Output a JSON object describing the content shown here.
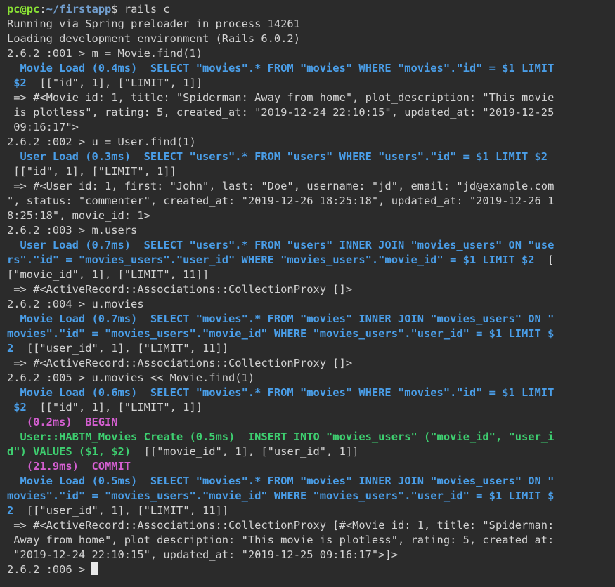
{
  "colors": {
    "background": "#2b2b2b",
    "default": "#d3d3d3",
    "prompt_user": "#8ae234",
    "prompt_path": "#729fcf",
    "sql_blue": "#4a9ee8",
    "sql_magenta": "#d45fd0",
    "sql_green": "#3ecf70"
  },
  "terminal": {
    "lines": [
      [
        {
          "t": "pc@pc",
          "c": "prompt_user",
          "b": true
        },
        {
          "t": ":",
          "c": "default"
        },
        {
          "t": "~/firstapp",
          "c": "prompt_path",
          "b": true
        },
        {
          "t": "$ rails c",
          "c": "default"
        }
      ],
      [
        {
          "t": "Running via Spring preloader in process 14261",
          "c": "default"
        }
      ],
      [
        {
          "t": "Loading development environment (Rails 6.0.2)",
          "c": "default"
        }
      ],
      [
        {
          "t": "2.6.2 :001 > m = Movie.find(1)",
          "c": "default"
        }
      ],
      [
        {
          "t": "  Movie Load (0.4ms)  SELECT \"movies\".* FROM \"movies\" WHERE \"movies\".\"id\" = $1 LIMIT",
          "c": "sql_blue",
          "b": true
        }
      ],
      [
        {
          "t": " $2",
          "c": "sql_blue",
          "b": true
        },
        {
          "t": "  [[\"id\", 1], [\"LIMIT\", 1]]",
          "c": "default"
        }
      ],
      [
        {
          "t": " => #<Movie id: 1, title: \"Spiderman: Away from home\", plot_description: \"This movie",
          "c": "default"
        }
      ],
      [
        {
          "t": " is plotless\", rating: 5, created_at: \"2019-12-24 22:10:15\", updated_at: \"2019-12-25",
          "c": "default"
        }
      ],
      [
        {
          "t": " 09:16:17\">",
          "c": "default"
        }
      ],
      [
        {
          "t": "2.6.2 :002 > u = User.find(1)",
          "c": "default"
        }
      ],
      [
        {
          "t": "  User Load (0.3ms)  SELECT \"users\".* FROM \"users\" WHERE \"users\".\"id\" = $1 LIMIT $2",
          "c": "sql_blue",
          "b": true
        }
      ],
      [
        {
          "t": " [[\"id\", 1], [\"LIMIT\", 1]]",
          "c": "default"
        }
      ],
      [
        {
          "t": " => #<User id: 1, first: \"John\", last: \"Doe\", username: \"jd\", email: \"jd@example.com",
          "c": "default"
        }
      ],
      [
        {
          "t": "\", status: \"commenter\", created_at: \"2019-12-26 18:25:18\", updated_at: \"2019-12-26 1",
          "c": "default"
        }
      ],
      [
        {
          "t": "8:25:18\", movie_id: 1>",
          "c": "default"
        }
      ],
      [
        {
          "t": "2.6.2 :003 > m.users",
          "c": "default"
        }
      ],
      [
        {
          "t": "  User Load (0.7ms)  SELECT \"users\".* FROM \"users\" INNER JOIN \"movies_users\" ON \"use",
          "c": "sql_blue",
          "b": true
        }
      ],
      [
        {
          "t": "rs\".\"id\" = \"movies_users\".\"user_id\" WHERE \"movies_users\".\"movie_id\" = $1 LIMIT $2",
          "c": "sql_blue",
          "b": true
        },
        {
          "t": "  [",
          "c": "default"
        }
      ],
      [
        {
          "t": "[\"movie_id\", 1], [\"LIMIT\", 11]]",
          "c": "default"
        }
      ],
      [
        {
          "t": " => #<ActiveRecord::Associations::CollectionProxy []>",
          "c": "default"
        }
      ],
      [
        {
          "t": "2.6.2 :004 > u.movies",
          "c": "default"
        }
      ],
      [
        {
          "t": "  Movie Load (0.7ms)  SELECT \"movies\".* FROM \"movies\" INNER JOIN \"movies_users\" ON \"",
          "c": "sql_blue",
          "b": true
        }
      ],
      [
        {
          "t": "movies\".\"id\" = \"movies_users\".\"movie_id\" WHERE \"movies_users\".\"user_id\" = $1 LIMIT $",
          "c": "sql_blue",
          "b": true
        }
      ],
      [
        {
          "t": "2",
          "c": "sql_blue",
          "b": true
        },
        {
          "t": "  [[\"user_id\", 1], [\"LIMIT\", 11]]",
          "c": "default"
        }
      ],
      [
        {
          "t": " => #<ActiveRecord::Associations::CollectionProxy []>",
          "c": "default"
        }
      ],
      [
        {
          "t": "2.6.2 :005 > u.movies << Movie.find(1)",
          "c": "default"
        }
      ],
      [
        {
          "t": "  Movie Load (0.6ms)  SELECT \"movies\".* FROM \"movies\" WHERE \"movies\".\"id\" = $1 LIMIT",
          "c": "sql_blue",
          "b": true
        }
      ],
      [
        {
          "t": " $2",
          "c": "sql_blue",
          "b": true
        },
        {
          "t": "  [[\"id\", 1], [\"LIMIT\", 1]]",
          "c": "default"
        }
      ],
      [
        {
          "t": "   (0.2ms)  BEGIN",
          "c": "sql_magenta",
          "b": true
        }
      ],
      [
        {
          "t": "  User::HABTM_Movies Create (0.5ms)  INSERT INTO \"movies_users\" (\"movie_id\", \"user_i",
          "c": "sql_green",
          "b": true
        }
      ],
      [
        {
          "t": "d\") VALUES ($1, $2)",
          "c": "sql_green",
          "b": true
        },
        {
          "t": "  [[\"movie_id\", 1], [\"user_id\", 1]]",
          "c": "default"
        }
      ],
      [
        {
          "t": "   (21.9ms)  COMMIT",
          "c": "sql_magenta",
          "b": true
        }
      ],
      [
        {
          "t": "  Movie Load (0.5ms)  SELECT \"movies\".* FROM \"movies\" INNER JOIN \"movies_users\" ON \"",
          "c": "sql_blue",
          "b": true
        }
      ],
      [
        {
          "t": "movies\".\"id\" = \"movies_users\".\"movie_id\" WHERE \"movies_users\".\"user_id\" = $1 LIMIT $",
          "c": "sql_blue",
          "b": true
        }
      ],
      [
        {
          "t": "2",
          "c": "sql_blue",
          "b": true
        },
        {
          "t": "  [[\"user_id\", 1], [\"LIMIT\", 11]]",
          "c": "default"
        }
      ],
      [
        {
          "t": " => #<ActiveRecord::Associations::CollectionProxy [#<Movie id: 1, title: \"Spiderman:",
          "c": "default"
        }
      ],
      [
        {
          "t": " Away from home\", plot_description: \"This movie is plotless\", rating: 5, created_at:",
          "c": "default"
        }
      ],
      [
        {
          "t": " \"2019-12-24 22:10:15\", updated_at: \"2019-12-25 09:16:17\">]>",
          "c": "default"
        }
      ]
    ],
    "active_prompt": "2.6.2 :006 > "
  }
}
